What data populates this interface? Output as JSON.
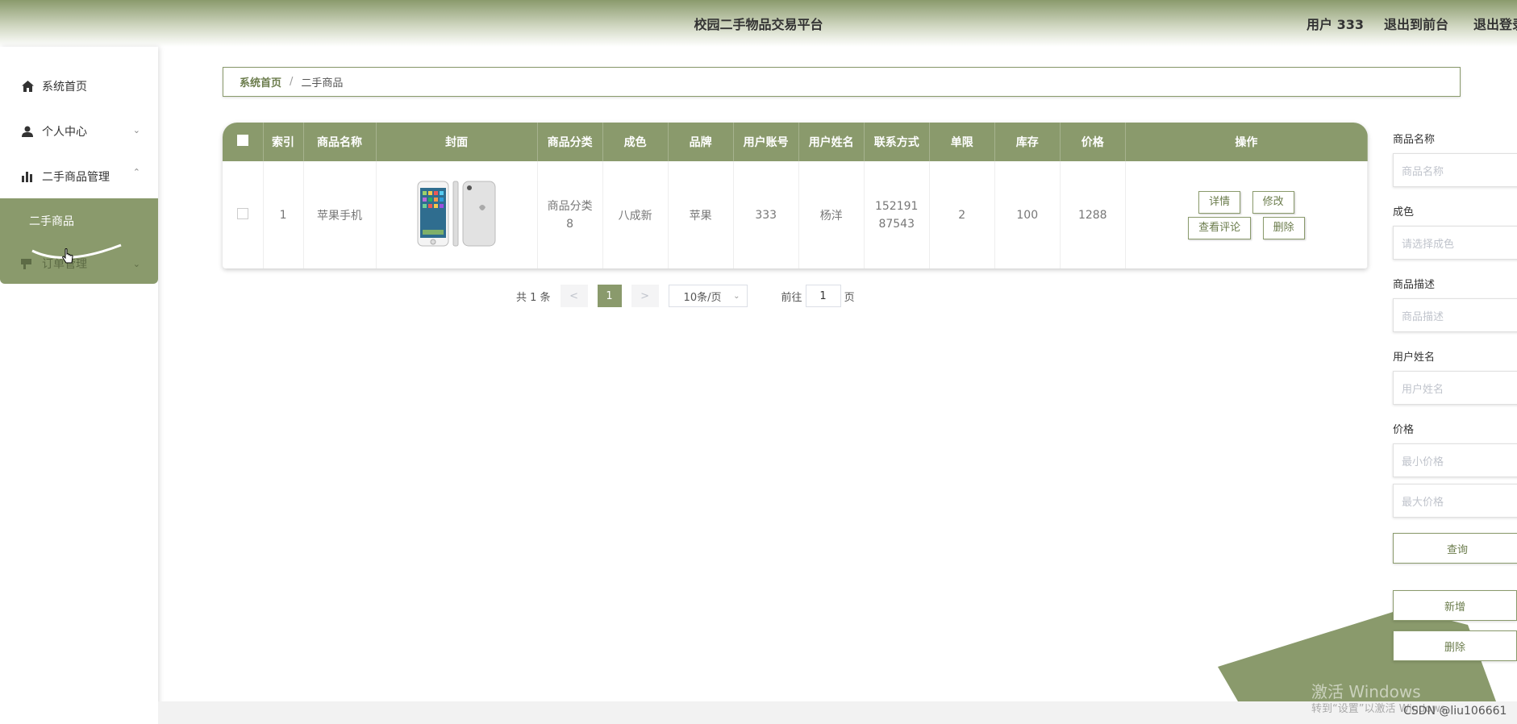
{
  "header": {
    "title": "校园二手物品交易平台",
    "user": "用户 333",
    "back_front": "退出到前台",
    "logout": "退出登录"
  },
  "sidebar": {
    "items": [
      {
        "label": "系统首页",
        "icon": "home-icon"
      },
      {
        "label": "个人中心",
        "icon": "user-icon"
      },
      {
        "label": "二手商品管理",
        "icon": "bar-chart-icon"
      },
      {
        "label": "订单管理",
        "icon": "order-icon"
      }
    ],
    "sub_active": "二手商品"
  },
  "breadcrumb": {
    "home": "系统首页",
    "separator": "/",
    "current": "二手商品"
  },
  "table": {
    "headers": [
      "索引",
      "商品名称",
      "封面",
      "商品分类",
      "成色",
      "品牌",
      "用户账号",
      "用户姓名",
      "联系方式",
      "单限",
      "库存",
      "价格",
      "操作"
    ],
    "rows": [
      {
        "index": "1",
        "name": "苹果手机",
        "category": "商品分类8",
        "condition": "八成新",
        "brand": "苹果",
        "account": "333",
        "username": "杨洋",
        "phone": "15219187543",
        "limit": "2",
        "stock": "100",
        "price": "1288"
      }
    ],
    "actions": {
      "detail": "详情",
      "edit": "修改",
      "comments": "查看评论",
      "delete": "删除"
    }
  },
  "pager": {
    "total": "共 1 条",
    "prev": "<",
    "current": "1",
    "next": ">",
    "size": "10条/页",
    "goto": "前往",
    "page_value": "1",
    "page_unit": "页"
  },
  "filters": {
    "name_label": "商品名称",
    "name_placeholder": "商品名称",
    "condition_label": "成色",
    "condition_placeholder": "请选择成色",
    "desc_label": "商品描述",
    "desc_placeholder": "商品描述",
    "username_label": "用户姓名",
    "username_placeholder": "用户姓名",
    "price_label": "价格",
    "min_placeholder": "最小价格",
    "max_placeholder": "最大价格",
    "query": "查询",
    "add": "新增",
    "delete": "删除"
  },
  "overlay": {
    "watermark": "激活 Windows",
    "watermark_sub": "转到“设置”以激活 Windows。",
    "csdn": "CSDN @liu106661"
  },
  "colors": {
    "accent": "#8a9a6c",
    "accent_dark": "#6b7c4c"
  }
}
